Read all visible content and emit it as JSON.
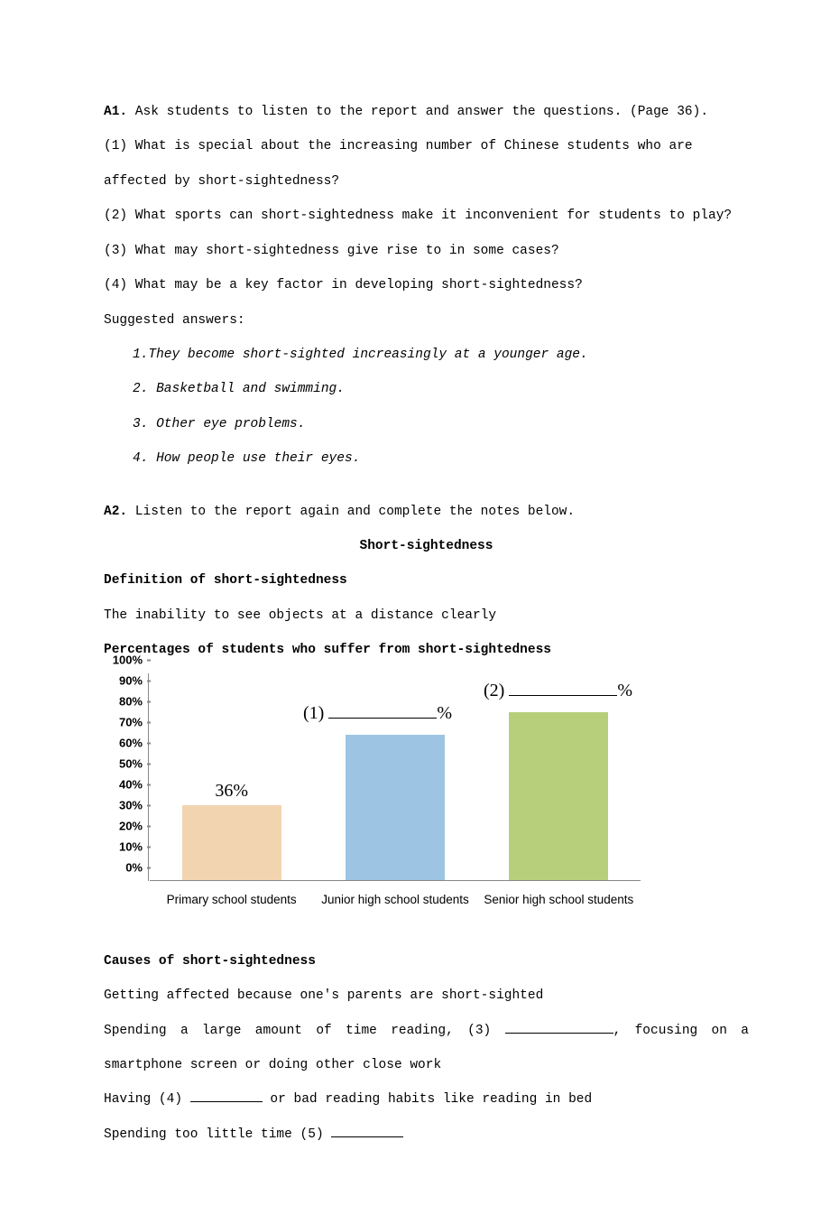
{
  "a1": {
    "heading": "A1.",
    "intro": " Ask students to listen to the report and answer the questions. (Page 36).",
    "q1": "(1) What is special about the increasing number of Chinese students who are affected by short-sightedness?",
    "q2": "(2) What sports can short-sightedness make it inconvenient for students to play?",
    "q3": "(3) What may short-sightedness give rise to in some cases?",
    "q4": "(4) What may be a key factor in developing short-sightedness?",
    "suggested": " Suggested answers:",
    "ans1": "1.They become short-sighted increasingly at a younger age.",
    "ans2": "2. Basketball and swimming.",
    "ans3": "3. Other eye problems.",
    "ans4": "4. How people use their eyes."
  },
  "a2": {
    "heading": "A2.",
    "intro": " Listen to the report again and complete the notes below.",
    "title": "Short-sightedness",
    "def_heading": "Definition of short-sightedness",
    "def_text": "The inability to see objects at a distance clearly",
    "pct_heading": "Percentages of students who suffer from short-sightedness",
    "causes_heading": "Causes of short-sightedness",
    "cause1": "Getting affected because one's parents are short-sighted",
    "cause2a": "Spending a large amount of time reading, (3) ",
    "cause2b": ", focusing on a smartphone screen or doing other close work",
    "cause3a": "Having (4) ",
    "cause3b": " or bad reading habits like reading in bed",
    "cause4a": "Spending too little time (5) "
  },
  "chart_data": {
    "type": "bar",
    "categories": [
      "Primary school students",
      "Junior high school students",
      "Senior high school students"
    ],
    "values": [
      36,
      70,
      81
    ],
    "value_labels": [
      "36%",
      "",
      ""
    ],
    "annotations": [
      {
        "idx": 1,
        "text_prefix": "(1) ",
        "text_suffix": "%"
      },
      {
        "idx": 2,
        "text_prefix": "(2) ",
        "text_suffix": "%"
      }
    ],
    "ylabel_ticks": [
      "0%",
      "10%",
      "20%",
      "30%",
      "40%",
      "50%",
      "60%",
      "70%",
      "80%",
      "90%",
      "100%"
    ],
    "ylim": [
      0,
      100
    ]
  }
}
